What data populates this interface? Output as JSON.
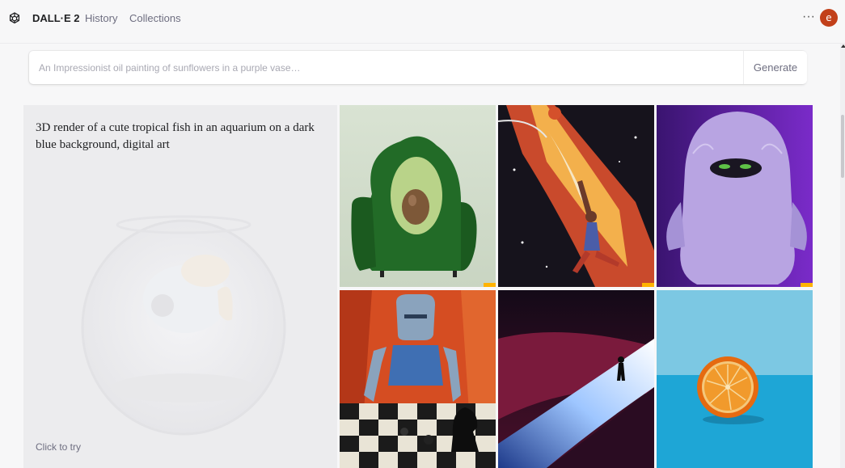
{
  "header": {
    "brand": "DALL·E 2",
    "nav": [
      "History",
      "Collections"
    ],
    "more_label": "···",
    "avatar_letter": "e",
    "avatar_color": "#c2401a"
  },
  "prompt": {
    "placeholder": "An Impressionist oil painting of sunflowers in a purple vase…",
    "value": "",
    "generate_label": "Generate"
  },
  "feature": {
    "caption": "3D render of a cute tropical fish in an aquarium on a dark blue background, digital art",
    "cta": "Click to try"
  },
  "gallery": {
    "tiles": [
      {
        "subject": "avocado-chair"
      },
      {
        "subject": "space-basketball"
      },
      {
        "subject": "purple-furry-monster"
      },
      {
        "subject": "robot-chess"
      },
      {
        "subject": "figure-in-light-dunes"
      },
      {
        "subject": "orange-half"
      }
    ]
  },
  "icons": {
    "logo": "openai-logo-icon",
    "more": "more-horizontal-icon"
  }
}
